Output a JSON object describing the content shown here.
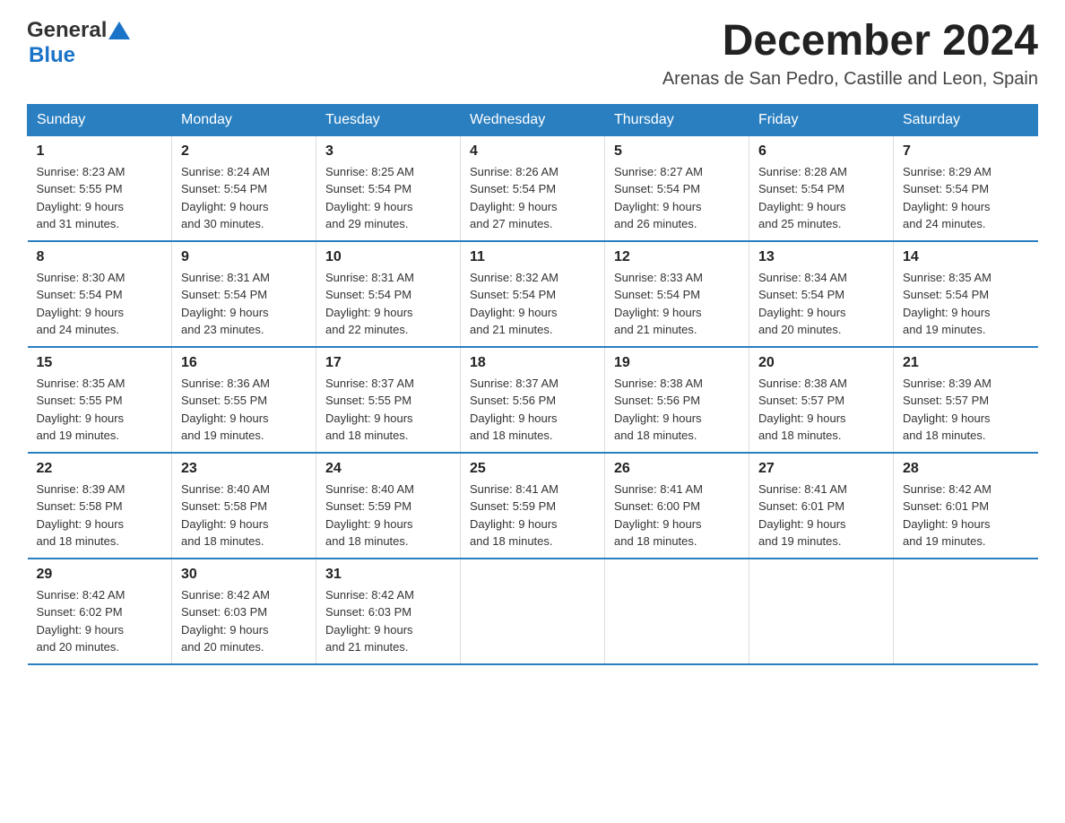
{
  "header": {
    "logo_general": "General",
    "logo_blue": "Blue",
    "main_title": "December 2024",
    "subtitle": "Arenas de San Pedro, Castille and Leon, Spain"
  },
  "days_of_week": [
    "Sunday",
    "Monday",
    "Tuesday",
    "Wednesday",
    "Thursday",
    "Friday",
    "Saturday"
  ],
  "weeks": [
    [
      {
        "day": "1",
        "sunrise": "8:23 AM",
        "sunset": "5:55 PM",
        "daylight": "9 hours and 31 minutes."
      },
      {
        "day": "2",
        "sunrise": "8:24 AM",
        "sunset": "5:54 PM",
        "daylight": "9 hours and 30 minutes."
      },
      {
        "day": "3",
        "sunrise": "8:25 AM",
        "sunset": "5:54 PM",
        "daylight": "9 hours and 29 minutes."
      },
      {
        "day": "4",
        "sunrise": "8:26 AM",
        "sunset": "5:54 PM",
        "daylight": "9 hours and 27 minutes."
      },
      {
        "day": "5",
        "sunrise": "8:27 AM",
        "sunset": "5:54 PM",
        "daylight": "9 hours and 26 minutes."
      },
      {
        "day": "6",
        "sunrise": "8:28 AM",
        "sunset": "5:54 PM",
        "daylight": "9 hours and 25 minutes."
      },
      {
        "day": "7",
        "sunrise": "8:29 AM",
        "sunset": "5:54 PM",
        "daylight": "9 hours and 24 minutes."
      }
    ],
    [
      {
        "day": "8",
        "sunrise": "8:30 AM",
        "sunset": "5:54 PM",
        "daylight": "9 hours and 24 minutes."
      },
      {
        "day": "9",
        "sunrise": "8:31 AM",
        "sunset": "5:54 PM",
        "daylight": "9 hours and 23 minutes."
      },
      {
        "day": "10",
        "sunrise": "8:31 AM",
        "sunset": "5:54 PM",
        "daylight": "9 hours and 22 minutes."
      },
      {
        "day": "11",
        "sunrise": "8:32 AM",
        "sunset": "5:54 PM",
        "daylight": "9 hours and 21 minutes."
      },
      {
        "day": "12",
        "sunrise": "8:33 AM",
        "sunset": "5:54 PM",
        "daylight": "9 hours and 21 minutes."
      },
      {
        "day": "13",
        "sunrise": "8:34 AM",
        "sunset": "5:54 PM",
        "daylight": "9 hours and 20 minutes."
      },
      {
        "day": "14",
        "sunrise": "8:35 AM",
        "sunset": "5:54 PM",
        "daylight": "9 hours and 19 minutes."
      }
    ],
    [
      {
        "day": "15",
        "sunrise": "8:35 AM",
        "sunset": "5:55 PM",
        "daylight": "9 hours and 19 minutes."
      },
      {
        "day": "16",
        "sunrise": "8:36 AM",
        "sunset": "5:55 PM",
        "daylight": "9 hours and 19 minutes."
      },
      {
        "day": "17",
        "sunrise": "8:37 AM",
        "sunset": "5:55 PM",
        "daylight": "9 hours and 18 minutes."
      },
      {
        "day": "18",
        "sunrise": "8:37 AM",
        "sunset": "5:56 PM",
        "daylight": "9 hours and 18 minutes."
      },
      {
        "day": "19",
        "sunrise": "8:38 AM",
        "sunset": "5:56 PM",
        "daylight": "9 hours and 18 minutes."
      },
      {
        "day": "20",
        "sunrise": "8:38 AM",
        "sunset": "5:57 PM",
        "daylight": "9 hours and 18 minutes."
      },
      {
        "day": "21",
        "sunrise": "8:39 AM",
        "sunset": "5:57 PM",
        "daylight": "9 hours and 18 minutes."
      }
    ],
    [
      {
        "day": "22",
        "sunrise": "8:39 AM",
        "sunset": "5:58 PM",
        "daylight": "9 hours and 18 minutes."
      },
      {
        "day": "23",
        "sunrise": "8:40 AM",
        "sunset": "5:58 PM",
        "daylight": "9 hours and 18 minutes."
      },
      {
        "day": "24",
        "sunrise": "8:40 AM",
        "sunset": "5:59 PM",
        "daylight": "9 hours and 18 minutes."
      },
      {
        "day": "25",
        "sunrise": "8:41 AM",
        "sunset": "5:59 PM",
        "daylight": "9 hours and 18 minutes."
      },
      {
        "day": "26",
        "sunrise": "8:41 AM",
        "sunset": "6:00 PM",
        "daylight": "9 hours and 18 minutes."
      },
      {
        "day": "27",
        "sunrise": "8:41 AM",
        "sunset": "6:01 PM",
        "daylight": "9 hours and 19 minutes."
      },
      {
        "day": "28",
        "sunrise": "8:42 AM",
        "sunset": "6:01 PM",
        "daylight": "9 hours and 19 minutes."
      }
    ],
    [
      {
        "day": "29",
        "sunrise": "8:42 AM",
        "sunset": "6:02 PM",
        "daylight": "9 hours and 20 minutes."
      },
      {
        "day": "30",
        "sunrise": "8:42 AM",
        "sunset": "6:03 PM",
        "daylight": "9 hours and 20 minutes."
      },
      {
        "day": "31",
        "sunrise": "8:42 AM",
        "sunset": "6:03 PM",
        "daylight": "9 hours and 21 minutes."
      },
      null,
      null,
      null,
      null
    ]
  ],
  "labels": {
    "sunrise": "Sunrise:",
    "sunset": "Sunset:",
    "daylight": "Daylight:"
  }
}
